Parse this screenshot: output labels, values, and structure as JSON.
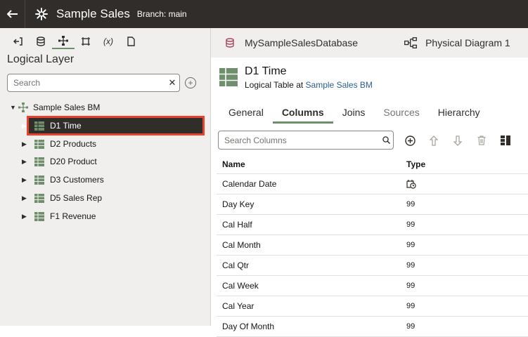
{
  "topbar": {
    "title": "Sample Sales",
    "branch": "Branch: main"
  },
  "left": {
    "toolbar": [
      {
        "name": "back-arrow-icon",
        "label": ""
      },
      {
        "name": "database-icon",
        "label": ""
      },
      {
        "name": "hierarchy-icon",
        "label": ""
      },
      {
        "name": "frame-icon",
        "label": ""
      },
      {
        "name": "variable-icon",
        "label": "(x)"
      },
      {
        "name": "document-icon",
        "label": ""
      }
    ],
    "title": "Logical Layer",
    "search_placeholder": "Search",
    "tree": {
      "root": "Sample Sales BM",
      "items": [
        "D1 Time",
        "D2 Products",
        "D20 Product",
        "D3 Customers",
        "D5 Sales Rep",
        "F1 Revenue"
      ],
      "selected": "D1 Time"
    }
  },
  "right": {
    "database": "MySampleSalesDatabase",
    "diagram": "Physical Diagram 1",
    "entity": {
      "title": "D1 Time",
      "type": "Logical Table",
      "at": "at",
      "parent": "Sample Sales BM"
    },
    "tabs": [
      "General",
      "Columns",
      "Joins",
      "Sources",
      "Hierarchy"
    ],
    "active_tab": "Columns",
    "column_search_placeholder": "Search Columns",
    "grid": {
      "headers": [
        "Name",
        "Type"
      ],
      "rows": [
        {
          "name": "Calendar Date",
          "type": ""
        },
        {
          "name": "Day Key",
          "type": "99"
        },
        {
          "name": "Cal Half",
          "type": "99"
        },
        {
          "name": "Cal Month",
          "type": "99"
        },
        {
          "name": "Cal Qtr",
          "type": "99"
        },
        {
          "name": "Cal Week",
          "type": "99"
        },
        {
          "name": "Cal Year",
          "type": "99"
        },
        {
          "name": "Day Of Month",
          "type": "99"
        }
      ]
    }
  },
  "colors": {
    "topbar": "#312d2a",
    "accent": "#6f8f6c",
    "highlight": "#e8412c",
    "link": "#2a5f8f"
  }
}
